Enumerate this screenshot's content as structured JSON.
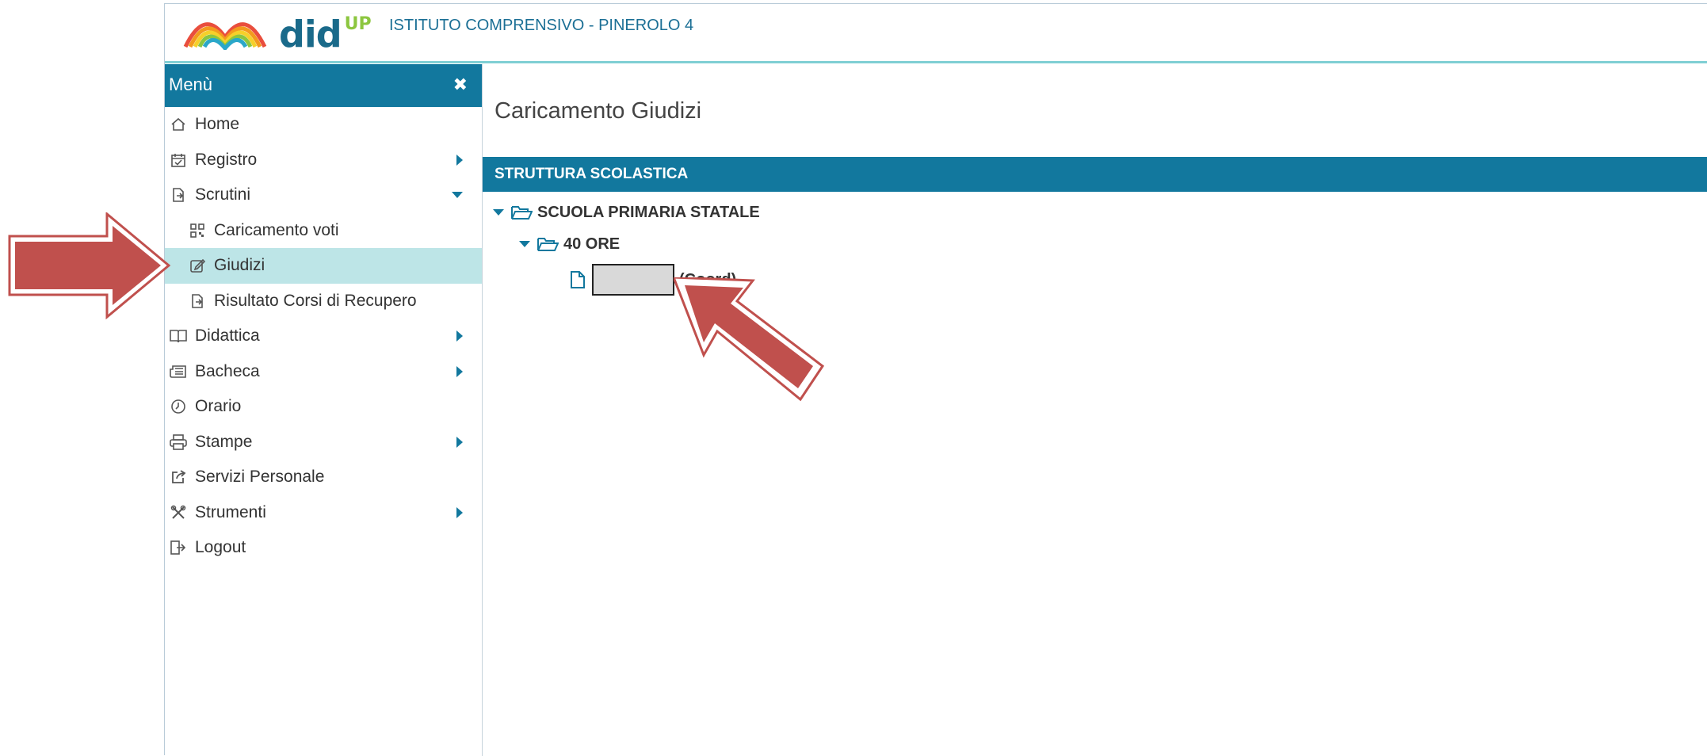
{
  "header": {
    "brand": "did",
    "brand_sup": "UP",
    "school": "ISTITUTO COMPRENSIVO - PINEROLO 4"
  },
  "sidebar": {
    "title": "Menù",
    "close": "✖",
    "items": [
      {
        "label": "Home",
        "icon": "home-icon",
        "arrow": "none"
      },
      {
        "label": "Registro",
        "icon": "calendar-check-icon",
        "arrow": "right"
      },
      {
        "label": "Scrutini",
        "icon": "file-export-icon",
        "arrow": "down"
      },
      {
        "label": "Caricamento voti",
        "icon": "qrcode-icon",
        "arrow": "none",
        "sub": true
      },
      {
        "label": "Giudizi",
        "icon": "edit-icon",
        "arrow": "none",
        "sub": true,
        "active": true
      },
      {
        "label": "Risultato Corsi di Recupero",
        "icon": "file-export-icon",
        "arrow": "none",
        "sub": true
      },
      {
        "label": "Didattica",
        "icon": "book-icon",
        "arrow": "right"
      },
      {
        "label": "Bacheca",
        "icon": "newspaper-icon",
        "arrow": "right"
      },
      {
        "label": "Orario",
        "icon": "clock-icon",
        "arrow": "none"
      },
      {
        "label": "Stampe",
        "icon": "print-icon",
        "arrow": "right"
      },
      {
        "label": "Servizi Personale",
        "icon": "share-square-icon",
        "arrow": "none"
      },
      {
        "label": "Strumenti",
        "icon": "tools-icon",
        "arrow": "right"
      },
      {
        "label": "Logout",
        "icon": "sign-out-icon",
        "arrow": "none"
      }
    ]
  },
  "main": {
    "title": "Caricamento Giudizi",
    "section": "STRUTTURA SCOLASTICA",
    "tree": {
      "school": "SCUOLA PRIMARIA STATALE",
      "group": "40 ORE",
      "class_suffix": "(Coord)"
    }
  },
  "colors": {
    "primary": "#12789e",
    "active_bg": "#bde5e7",
    "arrow_red": "#c0504d"
  }
}
